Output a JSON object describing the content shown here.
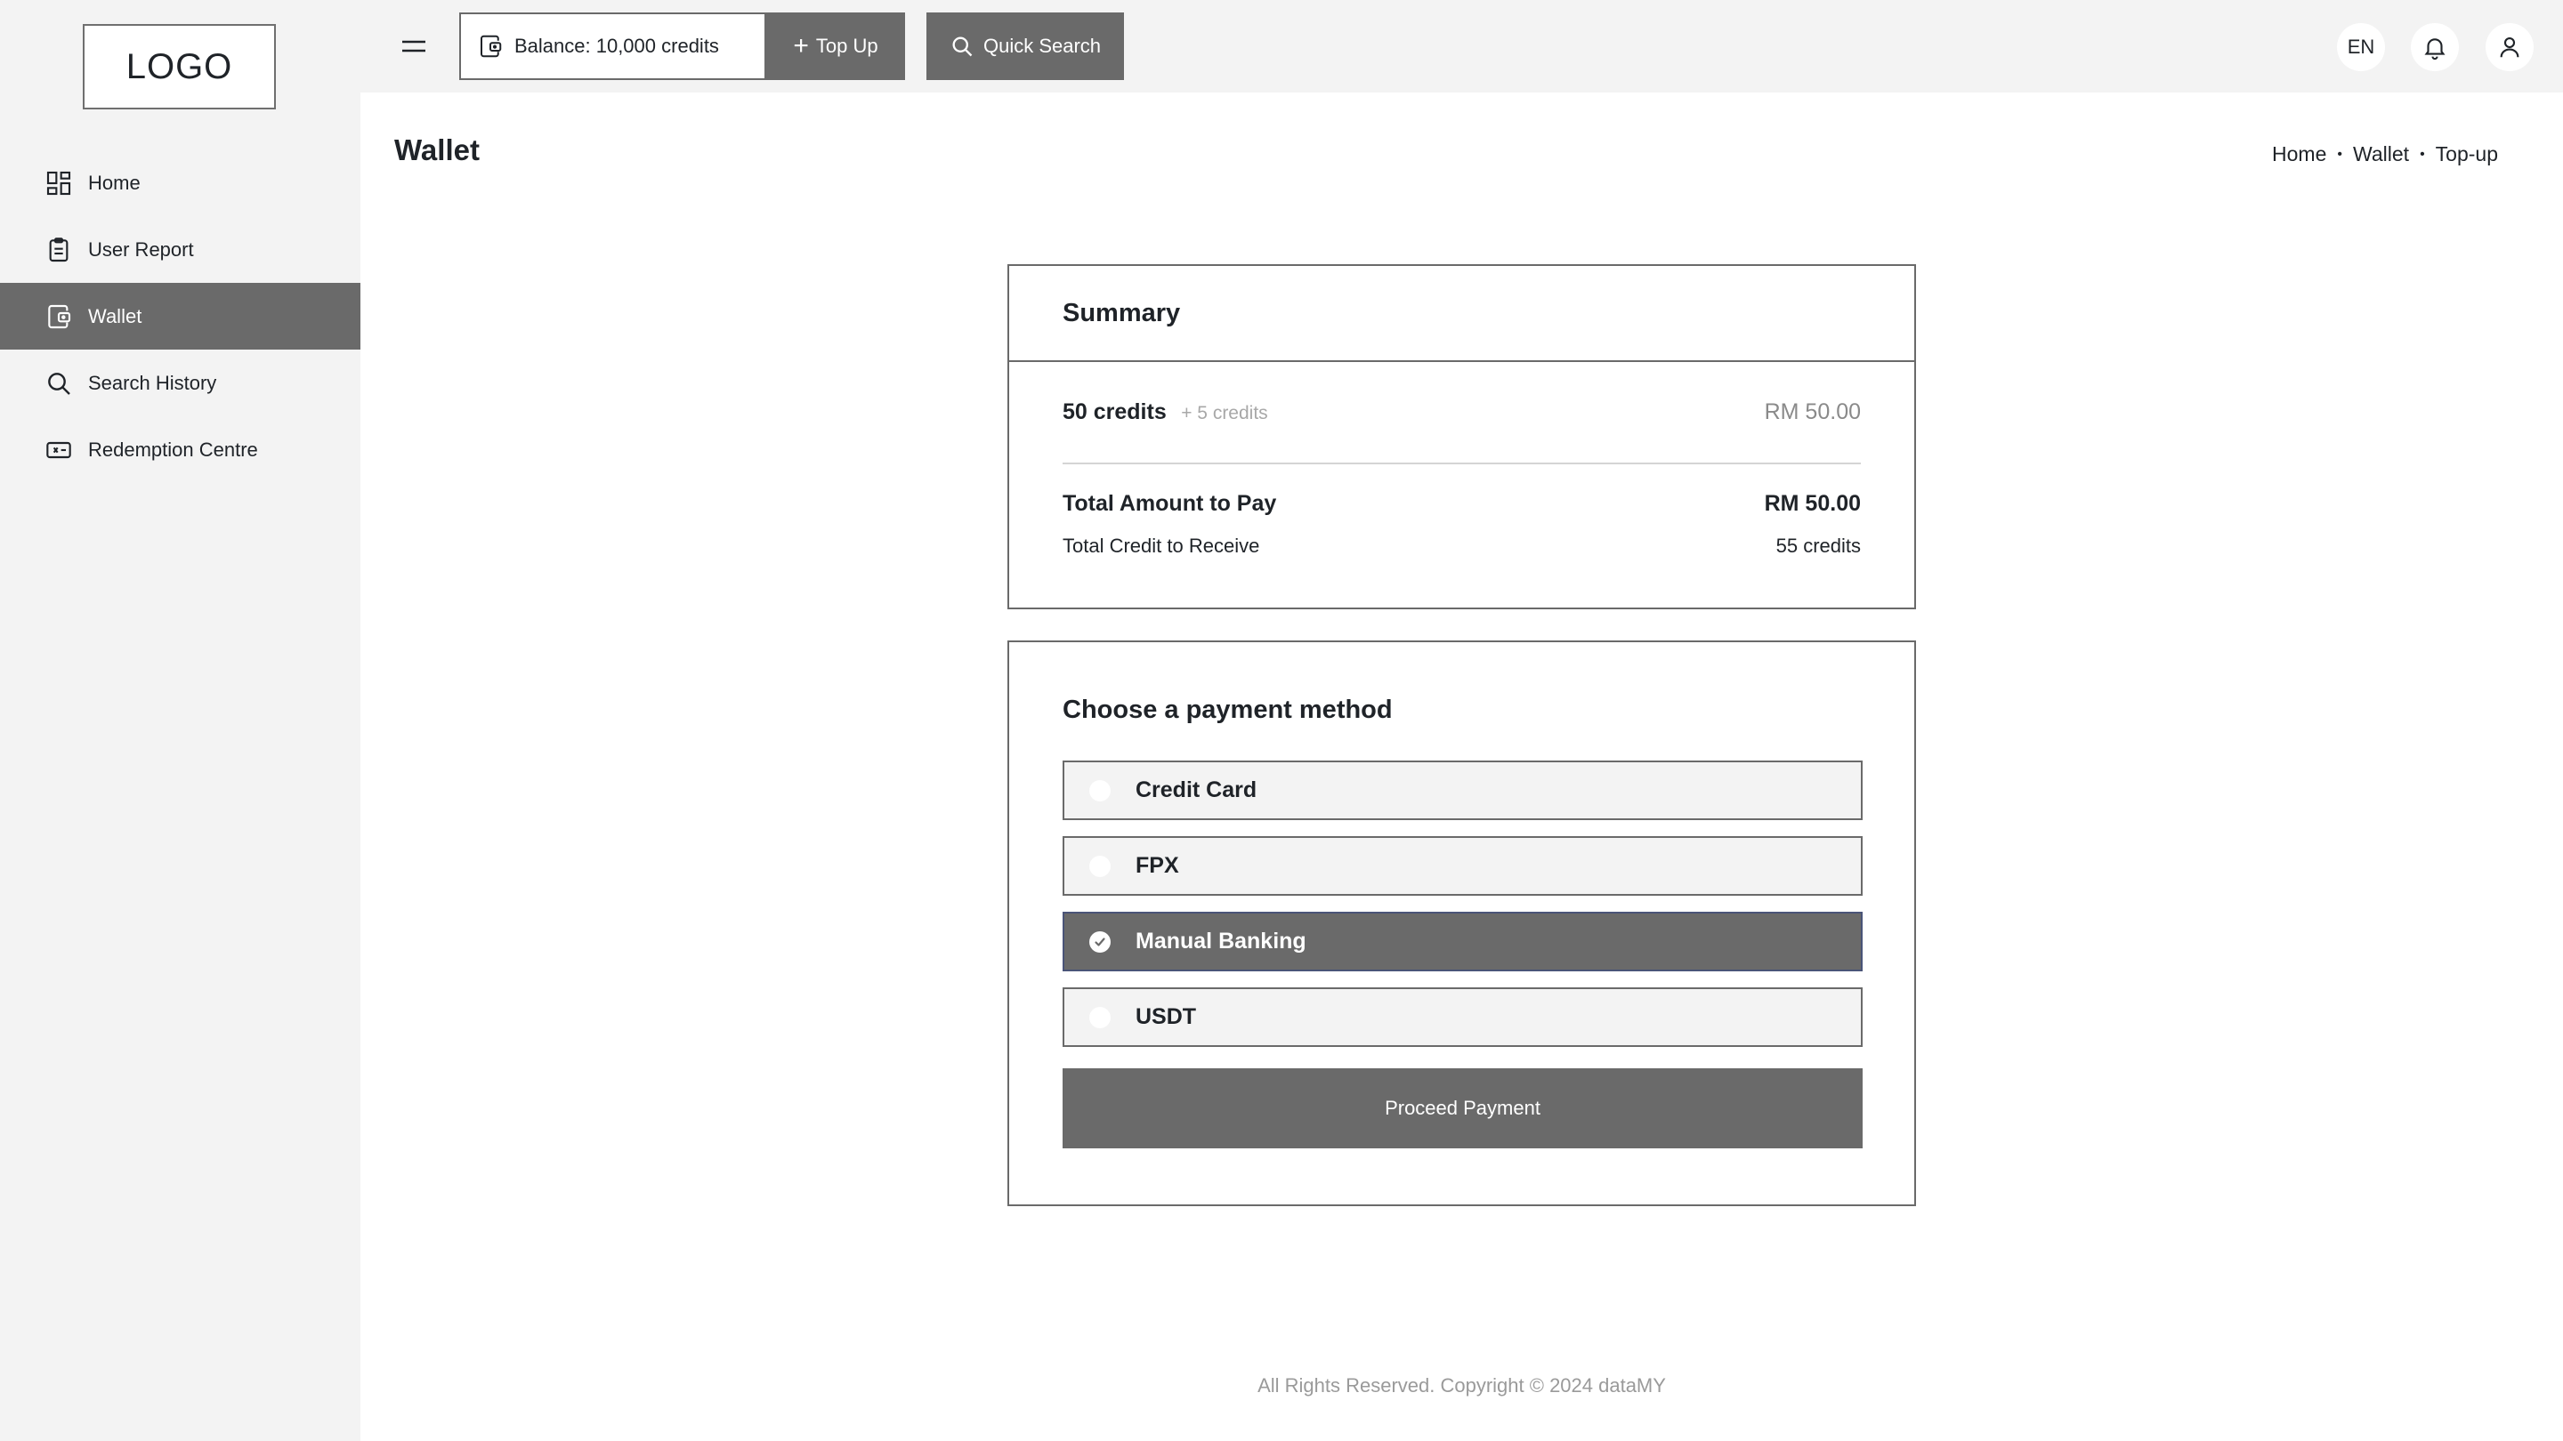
{
  "sidebar": {
    "logo": "LOGO",
    "items": [
      {
        "label": "Home",
        "icon": "grid-icon"
      },
      {
        "label": "User Report",
        "icon": "clipboard-icon"
      },
      {
        "label": "Wallet",
        "icon": "wallet-icon",
        "active": true
      },
      {
        "label": "Search History",
        "icon": "search-icon"
      },
      {
        "label": "Redemption Centre",
        "icon": "ticket-icon"
      }
    ]
  },
  "topbar": {
    "balance_label": "Balance: 10,000 credits",
    "topup_label": "Top Up",
    "quick_search_label": "Quick Search",
    "language": "EN"
  },
  "page": {
    "title": "Wallet",
    "breadcrumb": [
      "Home",
      "Wallet",
      "Top-up"
    ]
  },
  "summary": {
    "title": "Summary",
    "item_credits": "50 credits",
    "item_bonus": "+ 5 credits",
    "item_price": "RM 50.00",
    "total_pay_label": "Total Amount to Pay",
    "total_pay_value": "RM 50.00",
    "total_credit_label": "Total Credit to Receive",
    "total_credit_value": "55 credits"
  },
  "payment": {
    "title": "Choose a payment method",
    "methods": [
      {
        "label": "Credit Card",
        "selected": false
      },
      {
        "label": "FPX",
        "selected": false
      },
      {
        "label": "Manual Banking",
        "selected": true
      },
      {
        "label": "USDT",
        "selected": false
      }
    ],
    "proceed_label": "Proceed Payment"
  },
  "footer": {
    "text": "All Rights Reserved. Copyright © 2024 dataMY"
  },
  "colors": {
    "sidebar_bg": "#f3f3f3",
    "accent": "#6a6a6a",
    "selected_border": "#4a5478"
  }
}
